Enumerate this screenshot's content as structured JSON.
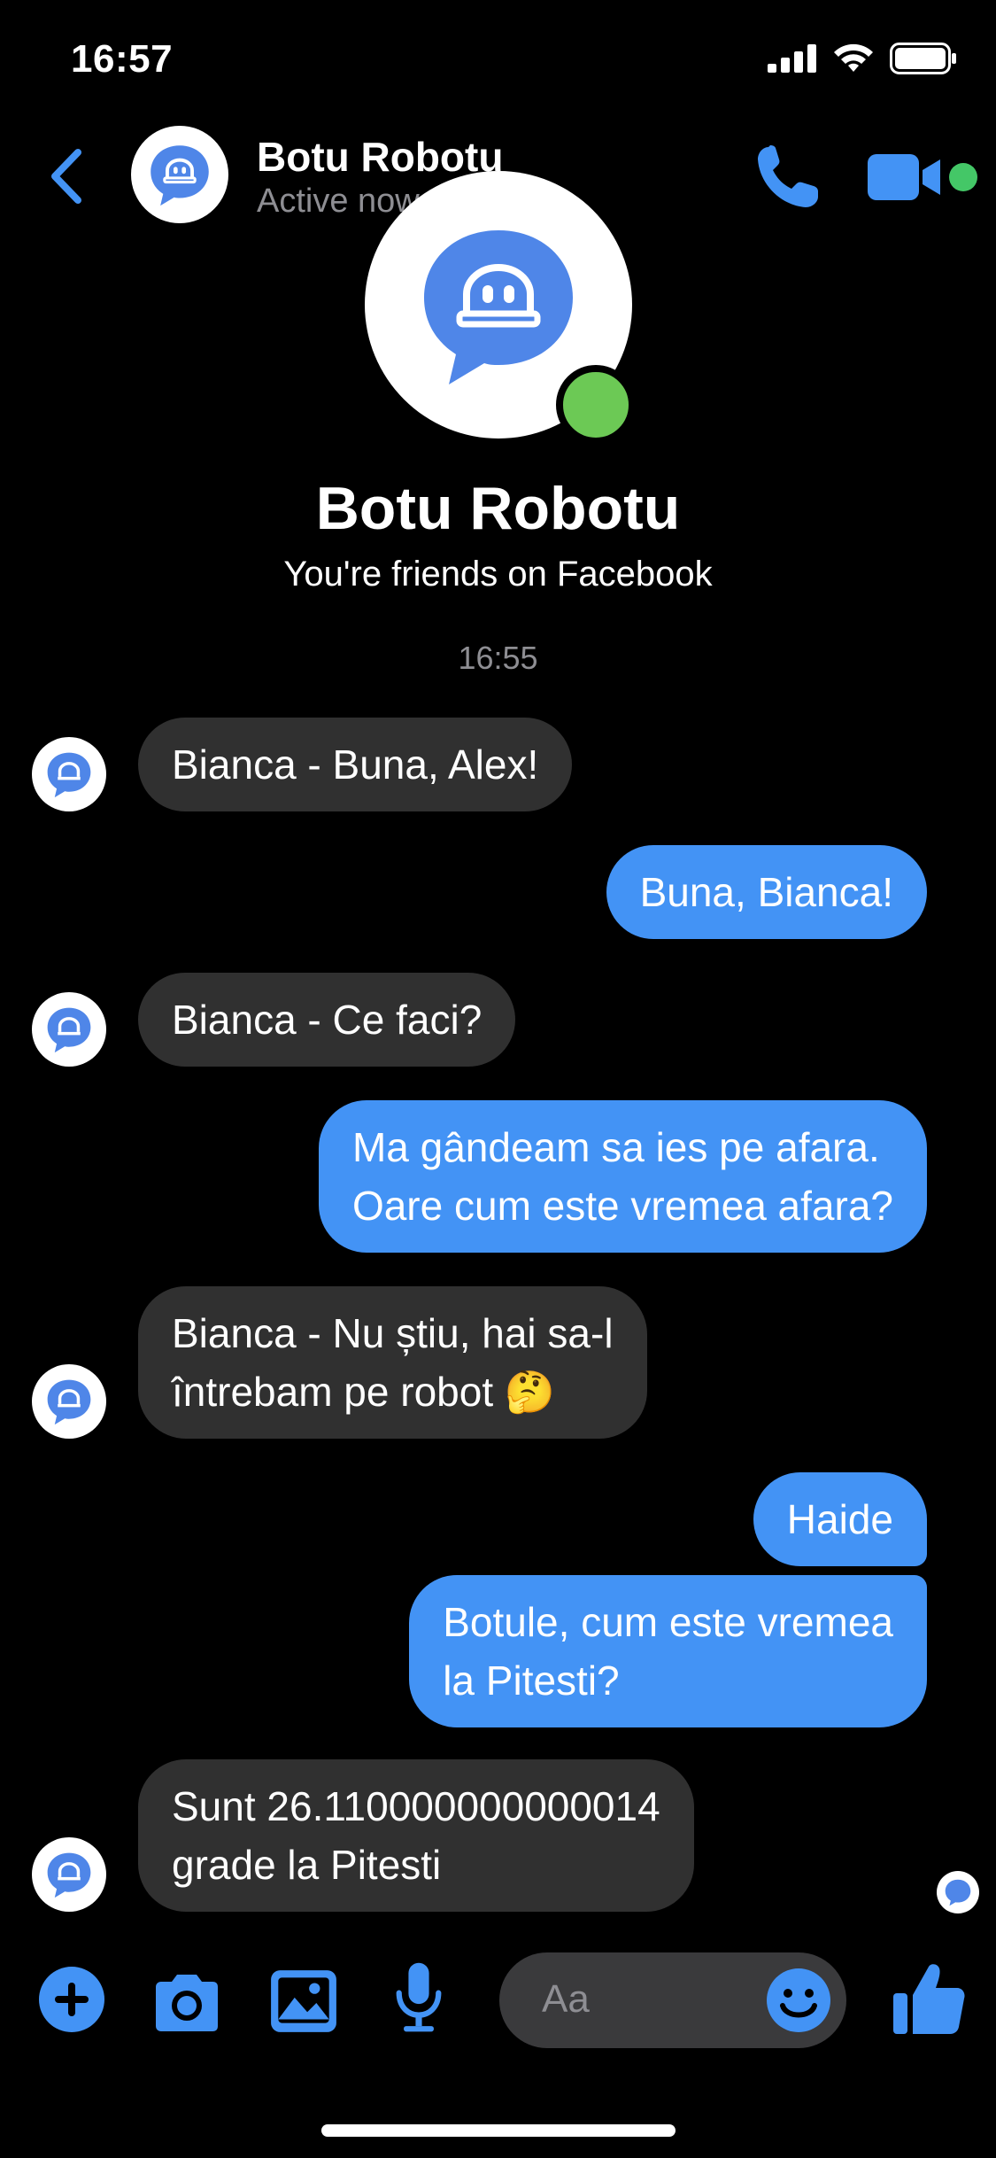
{
  "status_bar": {
    "time": "16:57"
  },
  "header": {
    "contact_name": "Botu Robotu",
    "contact_status": "Active now"
  },
  "profile": {
    "name": "Botu Robotu",
    "subtitle": "You're friends on Facebook"
  },
  "timestamp": "16:55",
  "messages": [
    {
      "from": "them",
      "lines": [
        "Bianca - Buna, Alex!"
      ]
    },
    {
      "from": "me",
      "lines": [
        "Buna, Bianca!"
      ]
    },
    {
      "from": "them",
      "lines": [
        "Bianca - Ce faci?"
      ]
    },
    {
      "from": "me",
      "lines": [
        "Ma gândeam sa ies pe afara.",
        "Oare cum este vremea afara?"
      ]
    },
    {
      "from": "them",
      "lines": [
        "Bianca - Nu știu, hai sa-l",
        "întrebam pe robot"
      ],
      "emoji": "🤔"
    },
    {
      "from": "me",
      "lines": [
        "Haide"
      ]
    },
    {
      "from": "me",
      "lines": [
        "Botule, cum este vremea",
        "la Pitesti?"
      ]
    },
    {
      "from": "them",
      "lines": [
        "Sunt 26.110000000000014",
        "grade la Pitesti"
      ]
    }
  ],
  "composer": {
    "placeholder": "Aa"
  },
  "colors": {
    "accent": "#4393f5",
    "incoming_bubble": "#303030",
    "online": "#6cc955"
  }
}
